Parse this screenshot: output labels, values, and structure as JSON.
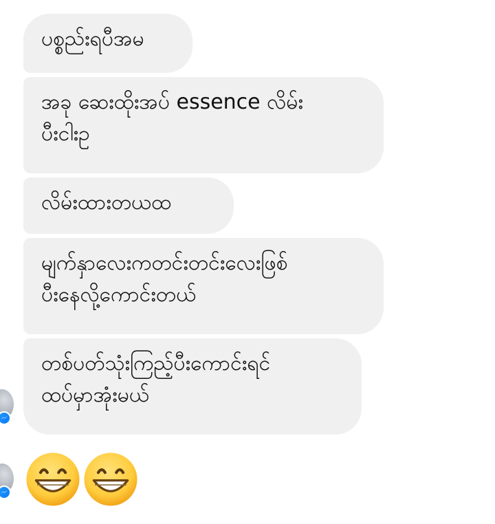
{
  "messages": [
    {
      "lines": [
        "ပစ္စည်းရပီအမ"
      ]
    },
    {
      "lines": [
        "အခု ဆေးထိုးအပ် essence လိမ်း",
        "ပီးငါးဥ"
      ]
    },
    {
      "lines": [
        "လိမ်းထားတယထ"
      ]
    },
    {
      "lines": [
        "မျက်နှာလေးကတင်းတင်းလေးဖြစ်",
        "ပီးနေလို့ကောင်းတယ်"
      ]
    },
    {
      "lines": [
        "တစ်ပတ်သုံးကြည့်ပီးကောင်းရင်",
        "ထပ်မှာအုံးမယ်"
      ]
    }
  ],
  "reaction": {
    "emojis": [
      "grinning-face-emoji",
      "grinning-face-emoji"
    ]
  },
  "icons": {
    "avatar": "avatar-icon",
    "badge": "messenger-badge-icon"
  },
  "colors": {
    "bubble_bg": "#f0f0f0",
    "text": "#111111",
    "messenger_blue": "#0a7cff",
    "emoji_yellow": "#ffcc3d"
  }
}
